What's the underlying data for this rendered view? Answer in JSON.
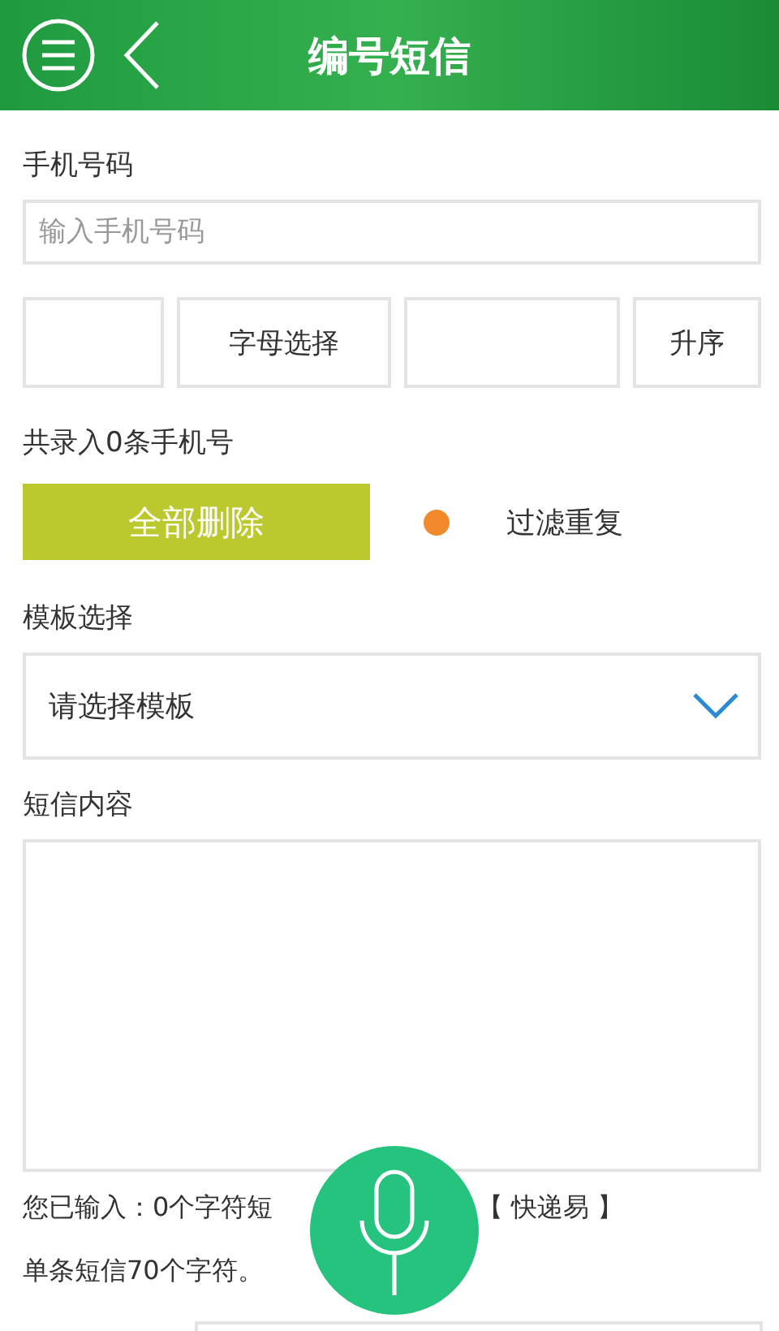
{
  "header": {
    "title": "编号短信"
  },
  "phone": {
    "label": "手机号码",
    "placeholder": "输入手机号码"
  },
  "sort_row": [
    {
      "kind": "blank"
    },
    {
      "kind": "button",
      "label": "字母选择"
    },
    {
      "kind": "blank"
    },
    {
      "kind": "button",
      "label": "升序"
    }
  ],
  "count_text": "共录入0条手机号",
  "delete_button": "全部删除",
  "filter": {
    "label": "过滤重复"
  },
  "template": {
    "label": "模板选择",
    "value": "请选择模板"
  },
  "content": {
    "label": "短信内容"
  },
  "notes": {
    "typed": "您已输入：0个字符短",
    "brand": "【 快递易 】",
    "limit": "单条短信70个字符。"
  }
}
